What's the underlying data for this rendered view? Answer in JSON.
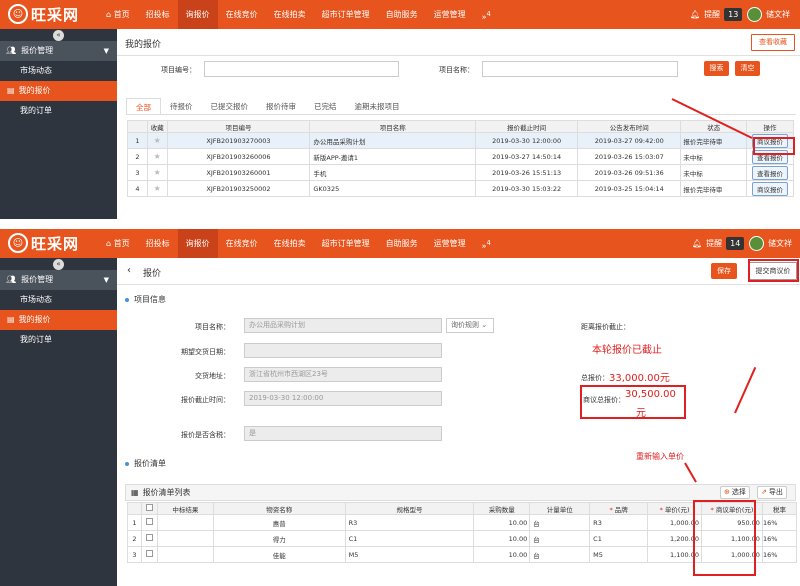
{
  "app": {
    "logo_text": "旺采网",
    "nav": [
      "首页",
      "招投标",
      "询报价",
      "在线竞价",
      "在线拍卖",
      "超市订单管理",
      "自助服务",
      "运营管理"
    ],
    "nav_more": "»",
    "nav_more_sup": "4",
    "remind_label": "提醒",
    "user_name": "储文祥"
  },
  "top": {
    "remind_count": "13",
    "sidebar": {
      "group": "报价管理",
      "items": [
        "市场动态",
        "我的报价",
        "我的订单"
      ]
    },
    "page_title": "我的报价",
    "view_fav_btn": "查看收藏",
    "search": {
      "code_label": "项目编号：",
      "name_label": "项目名称：",
      "search_btn": "搜索",
      "clear_btn": "清空"
    },
    "tabs": [
      "全部",
      "待报价",
      "已提交报价",
      "报价待审",
      "已完结",
      "逾期未报项目"
    ],
    "table": {
      "headers": [
        "",
        "收藏",
        "项目编号",
        "项目名称",
        "报价截止时间",
        "公告发布时间",
        "状态",
        "操作"
      ],
      "rows": [
        {
          "no": "1",
          "code": "XJFB201903270003",
          "name": "办公用品采购计划",
          "deadline": "2019-03-30 12:00:00",
          "publish": "2019-03-27 09:42:00",
          "status": "报价完毕待审",
          "op": "商议报价"
        },
        {
          "no": "2",
          "code": "XJFB201903260006",
          "name": "新版APP-邀请1",
          "deadline": "2019-03-27 14:50:14",
          "publish": "2019-03-26 15:03:07",
          "status": "未中标",
          "op": "查看报价"
        },
        {
          "no": "3",
          "code": "XJFB201903260001",
          "name": "手机",
          "deadline": "2019-03-26 15:51:13",
          "publish": "2019-03-26 09:51:36",
          "status": "未中标",
          "op": "查看报价"
        },
        {
          "no": "4",
          "code": "XJFB201903250002",
          "name": "GK0325",
          "deadline": "2019-03-30 15:03:22",
          "publish": "2019-03-25 15:04:14",
          "status": "报价完毕待审",
          "op": "商议报价"
        }
      ]
    }
  },
  "bottom": {
    "remind_count": "14",
    "sidebar": {
      "group": "报价管理",
      "items": [
        "市场动态",
        "我的报价",
        "我的订单"
      ]
    },
    "page_title": "报价",
    "save_btn": "保存",
    "submit_btn": "提交商议价",
    "section_project": "项目信息",
    "fields": {
      "name_label": "项目名称：",
      "name_value": "办公用品采购计划",
      "rule_btn": "询价规则",
      "date_label": "期望交货日期：",
      "addr_label": "交货地址：",
      "addr_value": "浙江省杭州市西湖区23号",
      "deadline_label": "报价截止时间：",
      "deadline_value": "2019-03-30 12:00:00",
      "tax_label": "报价是否含税：",
      "tax_value": "是"
    },
    "right": {
      "countdown_label": "距离报价截止：",
      "ended_text": "本轮报价已截止",
      "total_label": "总报价：",
      "total_value": "33,000.00元",
      "negotiate_label": "商议总报价：",
      "negotiate_value_1": "30,500.00",
      "negotiate_value_2": "元"
    },
    "section_list": "报价清单",
    "reenter_note": "重新输入单价",
    "list_title": "报价清单列表",
    "select_btn": "选择",
    "export_btn": "导出",
    "list_headers": [
      "",
      "",
      "中标结果",
      "物资名称",
      "规格型号",
      "采购数量",
      "计量单位",
      "品牌",
      "单价(元)",
      "商议单价(元)",
      "税率"
    ],
    "list_rows": [
      {
        "no": "1",
        "result": "",
        "name": "惠普",
        "model": "R3",
        "qty": "10.00",
        "unit": "台",
        "brand": "R3",
        "price": "1,000.00",
        "neg": "950.00",
        "tax": "16%"
      },
      {
        "no": "2",
        "result": "",
        "name": "得力",
        "model": "C1",
        "qty": "10.00",
        "unit": "台",
        "brand": "C1",
        "price": "1,200.00",
        "neg": "1,100.00",
        "tax": "16%"
      },
      {
        "no": "3",
        "result": "",
        "name": "佳能",
        "model": "M5",
        "qty": "10.00",
        "unit": "台",
        "brand": "M5",
        "price": "1,100.00",
        "neg": "1,000.00",
        "tax": "16%"
      }
    ]
  }
}
